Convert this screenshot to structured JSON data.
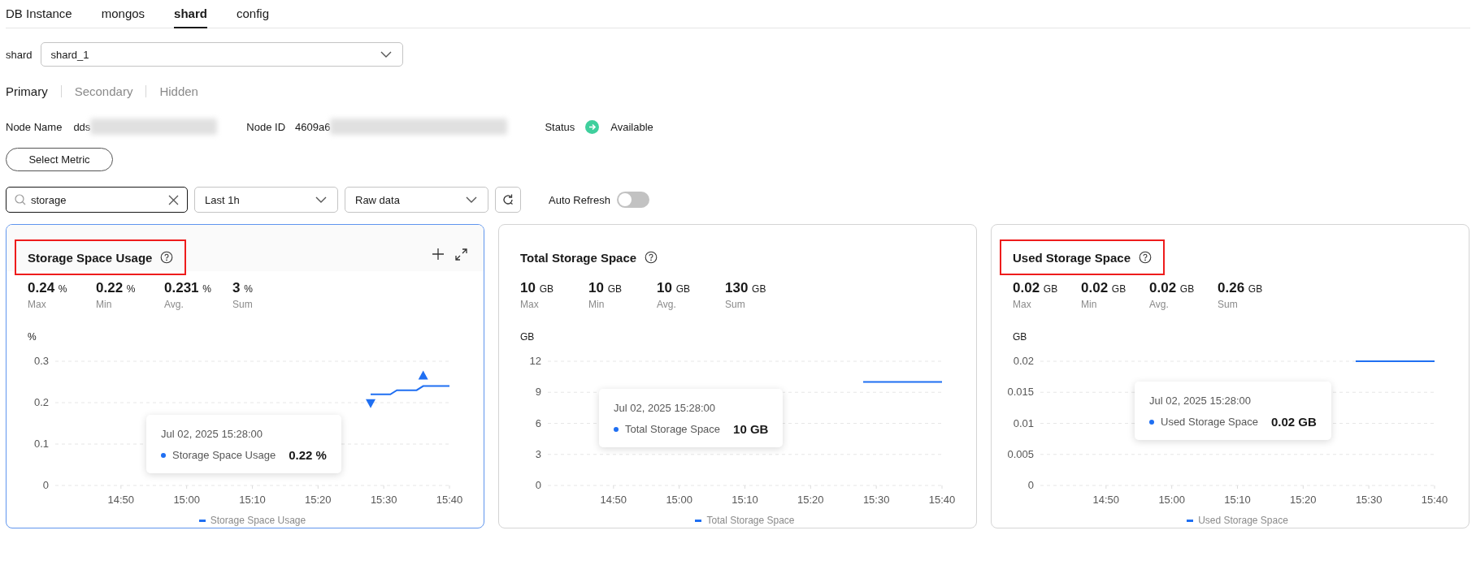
{
  "tabs": [
    {
      "label": "DB Instance",
      "selected": false
    },
    {
      "label": "mongos",
      "selected": false
    },
    {
      "label": "shard",
      "selected": true
    },
    {
      "label": "config",
      "selected": false
    }
  ],
  "shard_select": {
    "label": "shard",
    "value": "shard_1"
  },
  "node_tabs": [
    {
      "label": "Primary",
      "selected": true
    },
    {
      "label": "Secondary",
      "selected": false
    },
    {
      "label": "Hidden",
      "selected": false
    }
  ],
  "node_info": {
    "name_label": "Node Name",
    "name_value": "dds",
    "id_label": "Node ID",
    "id_value": "4609a6",
    "redacted": true,
    "status_label": "Status",
    "status": "Available"
  },
  "select_metric_button": "Select Metric",
  "search": {
    "value": "storage"
  },
  "period_select": {
    "value": "Last 1h"
  },
  "data_select": {
    "value": "Raw data"
  },
  "auto_refresh": {
    "label": "Auto Refresh",
    "on": false
  },
  "cards": [
    {
      "title": "Storage Space Usage",
      "selected": true,
      "highlighted": true,
      "stats": [
        {
          "value": "0.24",
          "unit": "%",
          "label": "Max"
        },
        {
          "value": "0.22",
          "unit": "%",
          "label": "Min"
        },
        {
          "value": "0.231",
          "unit": "%",
          "label": "Avg."
        },
        {
          "value": "3",
          "unit": "%",
          "label": "Sum"
        }
      ],
      "tooltip": {
        "time": "Jul 02, 2025 15:28:00",
        "series": "Storage Space Usage",
        "value": "0.22 %"
      },
      "chart_data": {
        "type": "line",
        "ylabel": "%",
        "categories": [
          null,
          null,
          null,
          null,
          null,
          null,
          null,
          null,
          null,
          null,
          "14:50",
          null,
          null,
          null,
          null,
          null,
          null,
          null,
          null,
          null,
          "15:00",
          null,
          null,
          null,
          null,
          null,
          null,
          null,
          null,
          null,
          "15:10",
          null,
          null,
          null,
          null,
          null,
          null,
          null,
          null,
          null,
          "15:20",
          null,
          null,
          null,
          null,
          null,
          null,
          null,
          null,
          null,
          "15:30",
          null,
          null,
          null,
          null,
          null,
          null,
          null,
          null,
          null,
          "15:40"
        ],
        "series": [
          {
            "name": "Storage Space Usage",
            "color": "#1f6ff2",
            "values": [
              null,
              null,
              null,
              null,
              null,
              null,
              null,
              null,
              null,
              null,
              null,
              null,
              null,
              null,
              null,
              null,
              null,
              null,
              null,
              null,
              null,
              null,
              null,
              null,
              null,
              null,
              null,
              null,
              null,
              null,
              null,
              null,
              null,
              null,
              null,
              null,
              null,
              null,
              null,
              null,
              null,
              null,
              null,
              null,
              null,
              null,
              null,
              null,
              0.22,
              0.22,
              0.22,
              0.22,
              0.23,
              0.23,
              0.23,
              0.23,
              0.24,
              0.24,
              0.24,
              0.24,
              0.24
            ]
          }
        ],
        "ylim": [
          0,
          0.3
        ],
        "yticks": [
          0,
          0.1,
          0.2,
          0.3
        ],
        "grid": true
      }
    },
    {
      "title": "Total Storage Space",
      "selected": false,
      "highlighted": false,
      "stats": [
        {
          "value": "10",
          "unit": "GB",
          "label": "Max"
        },
        {
          "value": "10",
          "unit": "GB",
          "label": "Min"
        },
        {
          "value": "10",
          "unit": "GB",
          "label": "Avg."
        },
        {
          "value": "130",
          "unit": "GB",
          "label": "Sum"
        }
      ],
      "tooltip": {
        "time": "Jul 02, 2025 15:28:00",
        "series": "Total Storage Space",
        "value": "10 GB"
      },
      "chart_data": {
        "type": "line",
        "ylabel": "GB",
        "categories": [
          null,
          null,
          null,
          null,
          null,
          null,
          null,
          null,
          null,
          null,
          "14:50",
          null,
          null,
          null,
          null,
          null,
          null,
          null,
          null,
          null,
          "15:00",
          null,
          null,
          null,
          null,
          null,
          null,
          null,
          null,
          null,
          "15:10",
          null,
          null,
          null,
          null,
          null,
          null,
          null,
          null,
          null,
          "15:20",
          null,
          null,
          null,
          null,
          null,
          null,
          null,
          null,
          null,
          "15:30",
          null,
          null,
          null,
          null,
          null,
          null,
          null,
          null,
          null,
          "15:40"
        ],
        "series": [
          {
            "name": "Total Storage Space",
            "color": "#1f6ff2",
            "values": [
              null,
              null,
              null,
              null,
              null,
              null,
              null,
              null,
              null,
              null,
              null,
              null,
              null,
              null,
              null,
              null,
              null,
              null,
              null,
              null,
              null,
              null,
              null,
              null,
              null,
              null,
              null,
              null,
              null,
              null,
              null,
              null,
              null,
              null,
              null,
              null,
              null,
              null,
              null,
              null,
              null,
              null,
              null,
              null,
              null,
              null,
              null,
              null,
              10,
              10,
              10,
              10,
              10,
              10,
              10,
              10,
              10,
              10,
              10,
              10,
              10
            ]
          }
        ],
        "ylim": [
          0,
          12
        ],
        "yticks": [
          0,
          3,
          6,
          9,
          12
        ],
        "grid": true
      }
    },
    {
      "title": "Used Storage Space",
      "selected": false,
      "highlighted": true,
      "stats": [
        {
          "value": "0.02",
          "unit": "GB",
          "label": "Max"
        },
        {
          "value": "0.02",
          "unit": "GB",
          "label": "Min"
        },
        {
          "value": "0.02",
          "unit": "GB",
          "label": "Avg."
        },
        {
          "value": "0.26",
          "unit": "GB",
          "label": "Sum"
        }
      ],
      "tooltip": {
        "time": "Jul 02, 2025 15:28:00",
        "series": "Used Storage Space",
        "value": "0.02 GB"
      },
      "chart_data": {
        "type": "line",
        "ylabel": "GB",
        "categories": [
          null,
          null,
          null,
          null,
          null,
          null,
          null,
          null,
          null,
          null,
          "14:50",
          null,
          null,
          null,
          null,
          null,
          null,
          null,
          null,
          null,
          "15:00",
          null,
          null,
          null,
          null,
          null,
          null,
          null,
          null,
          null,
          "15:10",
          null,
          null,
          null,
          null,
          null,
          null,
          null,
          null,
          null,
          "15:20",
          null,
          null,
          null,
          null,
          null,
          null,
          null,
          null,
          null,
          "15:30",
          null,
          null,
          null,
          null,
          null,
          null,
          null,
          null,
          null,
          "15:40"
        ],
        "series": [
          {
            "name": "Used Storage Space",
            "color": "#1f6ff2",
            "values": [
              null,
              null,
              null,
              null,
              null,
              null,
              null,
              null,
              null,
              null,
              null,
              null,
              null,
              null,
              null,
              null,
              null,
              null,
              null,
              null,
              null,
              null,
              null,
              null,
              null,
              null,
              null,
              null,
              null,
              null,
              null,
              null,
              null,
              null,
              null,
              null,
              null,
              null,
              null,
              null,
              null,
              null,
              null,
              null,
              null,
              null,
              null,
              null,
              0.02,
              0.02,
              0.02,
              0.02,
              0.02,
              0.02,
              0.02,
              0.02,
              0.02,
              0.02,
              0.02,
              0.02,
              0.02
            ]
          }
        ],
        "ylim": [
          0,
          0.02
        ],
        "yticks": [
          0,
          0.005,
          0.01,
          0.015,
          0.02
        ],
        "grid": true
      }
    }
  ]
}
